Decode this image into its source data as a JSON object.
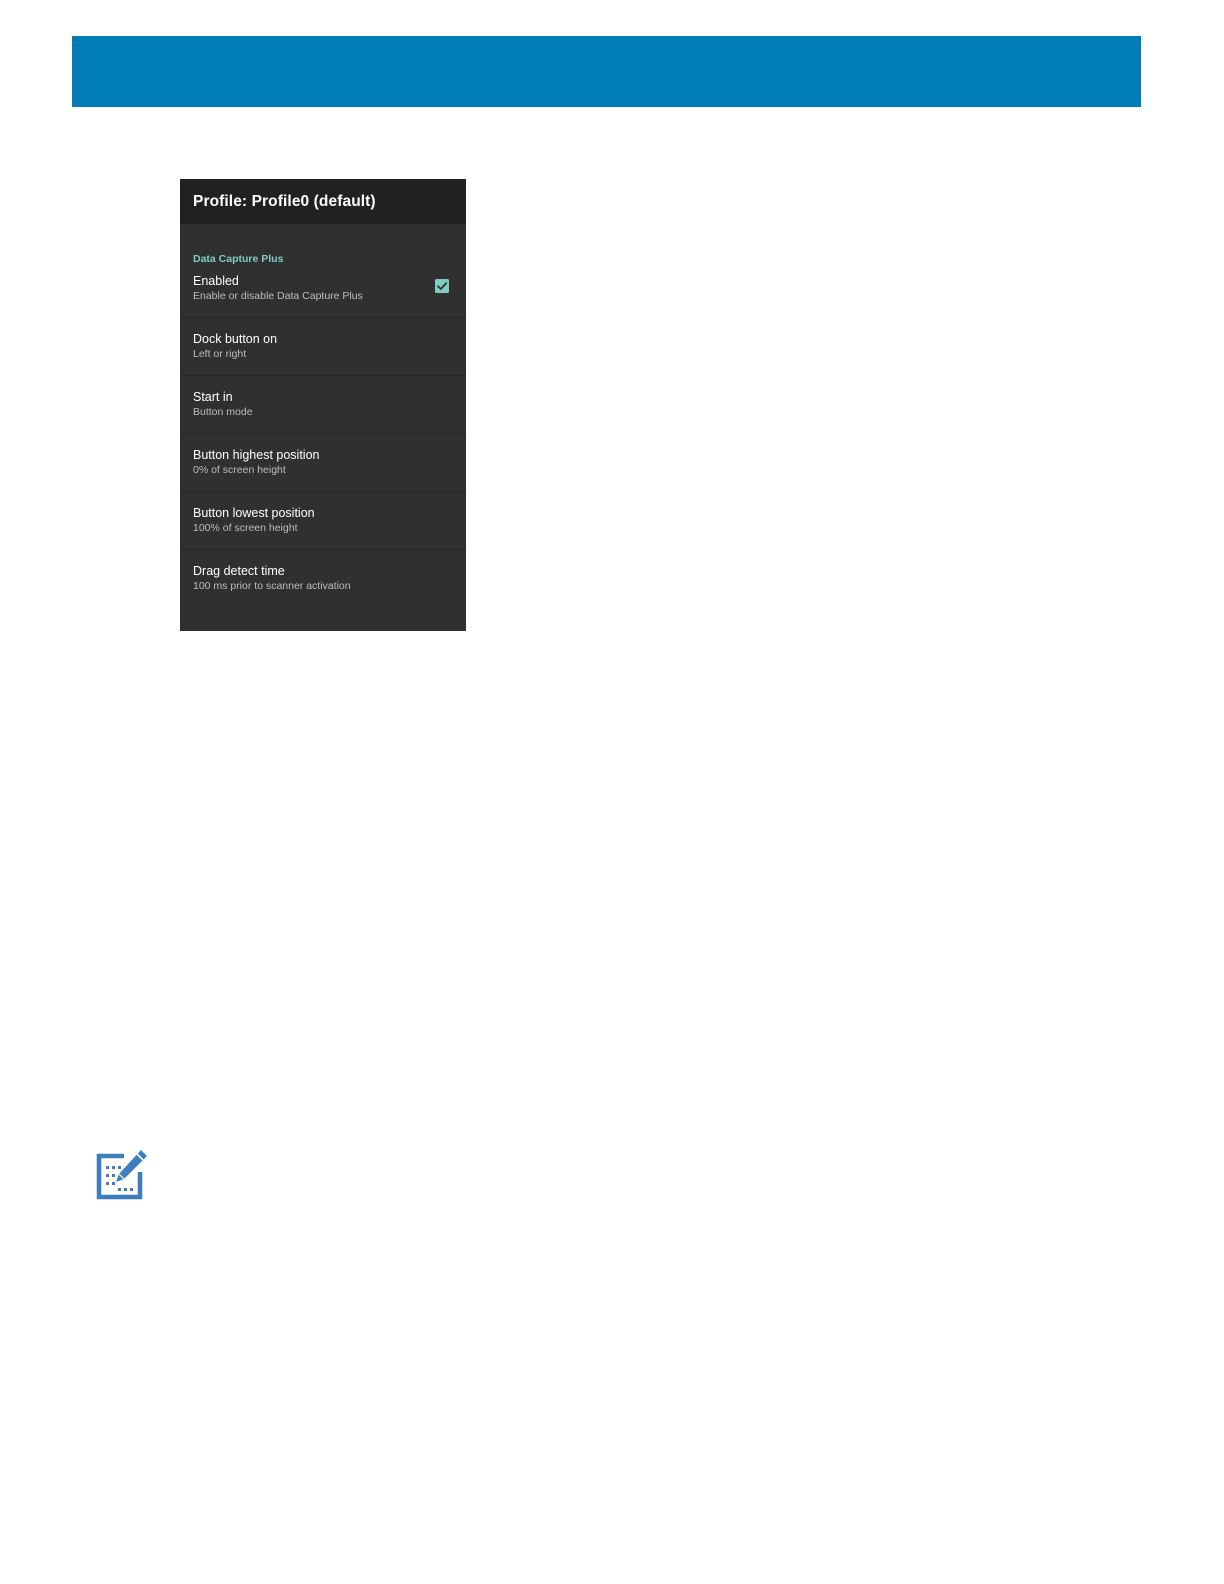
{
  "colors": {
    "header_band": "#007cb6",
    "screen_background": "#303030",
    "app_bar": "#212121",
    "accent": "#80cbc4",
    "note_icon": "#3d7ebf"
  },
  "screen": {
    "app_bar_title": "Profile: Profile0 (default)",
    "category": "Data Capture Plus",
    "preferences": [
      {
        "title": "Enabled",
        "summary": "Enable or disable Data Capture Plus",
        "checked": true
      },
      {
        "title": "Dock button on",
        "summary": "Left or right"
      },
      {
        "title": "Start in",
        "summary": "Button mode"
      },
      {
        "title": "Button highest position",
        "summary": "0% of screen height"
      },
      {
        "title": "Button lowest position",
        "summary": "100% of screen height"
      },
      {
        "title": "Drag detect time",
        "summary": "100 ms prior to scanner activation"
      }
    ]
  },
  "icons": {
    "checkbox": "check-icon",
    "note": "note-pencil-icon"
  }
}
